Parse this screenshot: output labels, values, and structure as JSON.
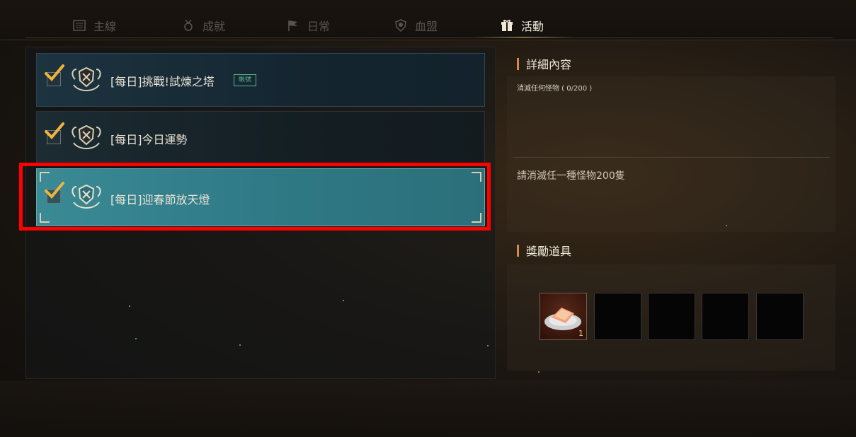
{
  "tabs": [
    {
      "label": "主線",
      "icon": "scroll-icon"
    },
    {
      "label": "成就",
      "icon": "medal-icon"
    },
    {
      "label": "日常",
      "icon": "flag-icon"
    },
    {
      "label": "血盟",
      "icon": "shield-icon"
    },
    {
      "label": "活動",
      "icon": "gift-icon",
      "active": true
    }
  ],
  "quests": [
    {
      "title": "[每日]挑戰!試煉之塔",
      "badge": "帳號",
      "checked": true
    },
    {
      "title": "[每日]今日運勢",
      "checked": true
    },
    {
      "title": "[每日]迎春節放天燈",
      "checked": true,
      "selected": true
    }
  ],
  "details": {
    "section_title": "詳細內容",
    "progress_text": "消滅任何怪物 ( 0/200 )",
    "description": "請消滅任一種怪物200隻"
  },
  "rewards": {
    "section_title": "獎勵道具",
    "slots": [
      {
        "item": "food-plate-icon",
        "quantity": "1"
      },
      {
        "item": "",
        "quantity": ""
      },
      {
        "item": "",
        "quantity": ""
      },
      {
        "item": "",
        "quantity": ""
      },
      {
        "item": "",
        "quantity": ""
      }
    ]
  },
  "colors": {
    "selected_quest": "#2f7a86",
    "highlight_border": "#ff0000",
    "section_bar": "#d58a48",
    "badge": "#5fb28a",
    "check": "#f0b43a"
  }
}
